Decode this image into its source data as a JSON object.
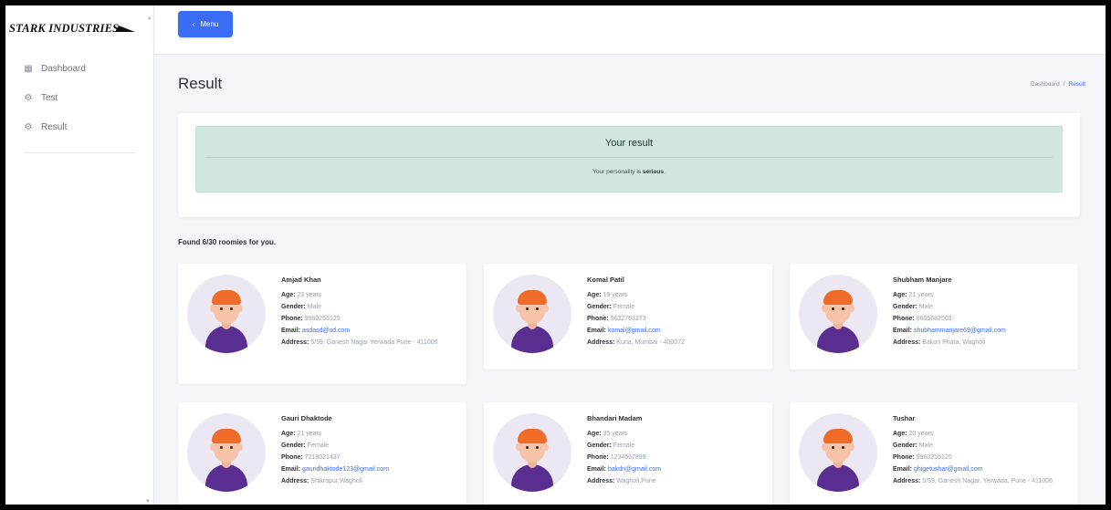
{
  "sidebar": {
    "logo": "STARK INDUSTRIES",
    "items": [
      {
        "label": "Dashboard",
        "icon": "grid-icon"
      },
      {
        "label": "Test",
        "icon": "cog-icon"
      },
      {
        "label": "Result",
        "icon": "cog-icon"
      }
    ]
  },
  "topbar": {
    "menu_label": "Menu"
  },
  "page": {
    "title": "Result",
    "breadcrumb": {
      "parent": "Dashboard",
      "separator": "/",
      "current": "Result"
    }
  },
  "result": {
    "title": "Your result",
    "text_prefix": "Your personality is",
    "personality": "serious",
    "text_suffix": "."
  },
  "found_text": "Found 6/30 roomies for you.",
  "labels": {
    "age": "Age:",
    "gender": "Gender:",
    "phone": "Phone:",
    "email": "Email:",
    "address": "Address:"
  },
  "roomies": [
    {
      "name": "Amjad Khan",
      "age": "23 years",
      "gender": "Male",
      "phone": "9960255125",
      "email": "asdasd@sd.com",
      "address": "5/59, Ganesh Nagar Yerwada Pune - 411006"
    },
    {
      "name": "Komal Patil",
      "age": "19 years",
      "gender": "Female",
      "phone": "9632763273",
      "email": "komal@gmail.com",
      "address": "Kurla, Mumbai - 400072"
    },
    {
      "name": "Shubham Manjare",
      "age": "21 years",
      "gender": "Male",
      "phone": "8605682503",
      "email": "shubhammanjare69@gmail.com",
      "address": "Bakori Phata, Wagholi"
    },
    {
      "name": "Gauri Dhaktode",
      "age": "21 years",
      "gender": "Female",
      "phone": "7218021437",
      "email": "gauridhaktode123@gmail.com",
      "address": "Shikrapur,Wagholi"
    },
    {
      "name": "Bhandari Madam",
      "age": "35 years",
      "gender": "Female",
      "phone": "1234567899",
      "email": "bakdn@gmail.com",
      "address": "Wagholi,Pune"
    },
    {
      "name": "Tushar",
      "age": "20 years",
      "gender": "Male",
      "phone": "9960255125",
      "email": "ghigetushar@gmail.com",
      "address": "5/59, Ganesh Nagar, Yerwada, Pune - 411006"
    }
  ],
  "colors": {
    "accent": "#3b6cf6",
    "success_bg": "#d1e7dd",
    "avatar_bg": "#ebe8f3"
  }
}
